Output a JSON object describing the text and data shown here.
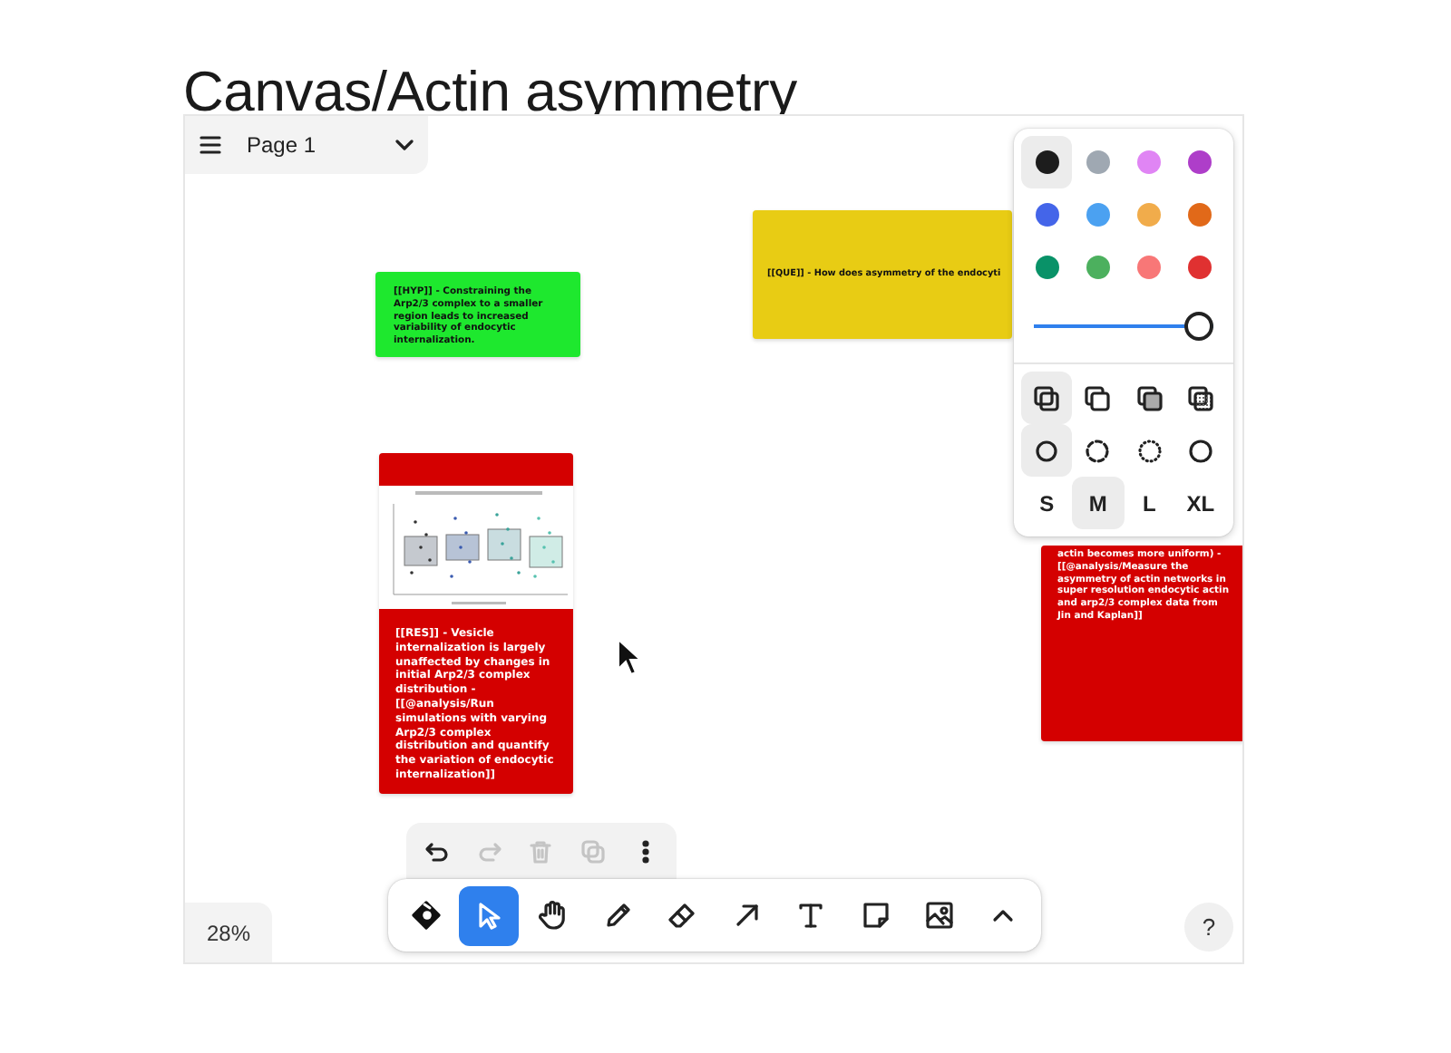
{
  "document": {
    "title": "Canvas/Actin asymmetry"
  },
  "page_menu": {
    "label": "Page 1"
  },
  "notes": [
    {
      "kind": "text",
      "color": "#1ee82e",
      "text": "[[HYP]] - Constraining the Arp2/3 complex to a smaller region leads to increased variability of endocytic internalization."
    },
    {
      "kind": "text",
      "color": "#e8cc14",
      "text": "[[QUE]] - How does asymmetry of the endocyti"
    },
    {
      "kind": "figure",
      "color": "#d40000",
      "text": "[[RES]] - Vesicle internalization is largely unaffected by changes in initial Arp2/3 complex distribution - [[@analysis/Run simulations with varying Arp2/3 complex distribution and quantify the variation of endocytic internalization]]"
    },
    {
      "kind": "text",
      "color": "#d40000",
      "text": "actin becomes more uniform) - [[@analysis/Measure the asymmetry of actin networks in super resolution endocytic actin and arp2/3 complex data from Jin and Kaplan]]"
    }
  ],
  "style_panel": {
    "colors": [
      {
        "color": "#1d1d1d",
        "selected": true
      },
      {
        "color": "#9fa8b2",
        "selected": false
      },
      {
        "color": "#e085f4",
        "selected": false
      },
      {
        "color": "#ae3ec9",
        "selected": false
      },
      {
        "color": "#4465e9",
        "selected": false
      },
      {
        "color": "#4ba1f1",
        "selected": false
      },
      {
        "color": "#f1ac4b",
        "selected": false
      },
      {
        "color": "#e16919",
        "selected": false
      },
      {
        "color": "#099268",
        "selected": false
      },
      {
        "color": "#4cb05e",
        "selected": false
      },
      {
        "color": "#f87777",
        "selected": false
      },
      {
        "color": "#e03131",
        "selected": false
      }
    ],
    "opacity": {
      "level": 1
    },
    "fills": [
      {
        "kind": "none",
        "selected": true
      },
      {
        "kind": "semi",
        "selected": false
      },
      {
        "kind": "solid",
        "selected": false
      },
      {
        "kind": "pattern",
        "selected": false
      }
    ],
    "dashes": [
      {
        "kind": "draw",
        "selected": true
      },
      {
        "kind": "dashed",
        "selected": false
      },
      {
        "kind": "dotted",
        "selected": false
      },
      {
        "kind": "solid",
        "selected": false
      }
    ],
    "sizes": [
      {
        "label": "S",
        "selected": false
      },
      {
        "label": "M",
        "selected": true
      },
      {
        "label": "L",
        "selected": false
      },
      {
        "label": "XL",
        "selected": false
      }
    ]
  },
  "actions": [
    {
      "kind": "undo",
      "disabled": false
    },
    {
      "kind": "redo",
      "disabled": true
    },
    {
      "kind": "delete",
      "disabled": true
    },
    {
      "kind": "duplicate",
      "disabled": true
    },
    {
      "kind": "more",
      "disabled": false
    }
  ],
  "tools": [
    {
      "kind": "logo",
      "selected": false
    },
    {
      "kind": "select",
      "selected": true
    },
    {
      "kind": "hand",
      "selected": false
    },
    {
      "kind": "draw",
      "selected": false
    },
    {
      "kind": "eraser",
      "selected": false
    },
    {
      "kind": "arrow",
      "selected": false
    },
    {
      "kind": "text",
      "selected": false
    },
    {
      "kind": "note",
      "selected": false
    },
    {
      "kind": "image",
      "selected": false
    },
    {
      "kind": "more",
      "selected": false
    }
  ],
  "zoom": {
    "label": "28%"
  },
  "help": {
    "label": "?"
  }
}
